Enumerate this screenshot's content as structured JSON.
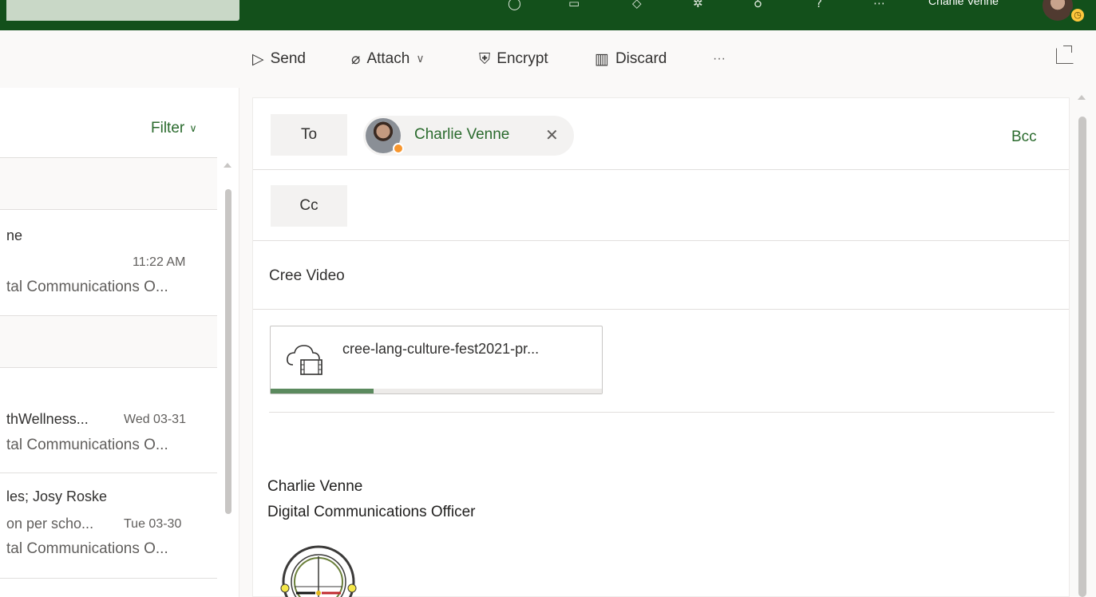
{
  "topbar": {
    "user_name": "Charlie Venne",
    "icons": [
      "skype-icon",
      "calendar-icon",
      "diamond-icon",
      "gear-icon",
      "lightbulb-icon",
      "help-icon",
      "feedback-icon"
    ],
    "bg_color": "#13501b"
  },
  "toolbar": {
    "send_label": "Send",
    "attach_label": "Attach",
    "encrypt_label": "Encrypt",
    "discard_label": "Discard",
    "more_label": "···"
  },
  "list": {
    "filter_label": "Filter",
    "items": [
      {
        "sender": "ne",
        "time": "11:22 AM",
        "preview": "tal Communications O..."
      },
      {
        "sender": "thWellness...",
        "time": "Wed 03-31",
        "preview": "tal Communications O..."
      },
      {
        "sender": "les; Josy Roske",
        "subject": "on per scho...",
        "time": "Tue 03-30",
        "preview": "tal Communications O..."
      }
    ]
  },
  "compose": {
    "to_label": "To",
    "cc_label": "Cc",
    "bcc_label": "Bcc",
    "recipient_name": "Charlie Venne",
    "subject": "Cree Video",
    "attachment": {
      "name": "cree-lang-culture-fest2021-pr...",
      "progress": 0.31
    },
    "signature": {
      "name": "Charlie Venne",
      "title": "Digital Communications Officer"
    }
  },
  "colors": {
    "accent": "#2b6b2e",
    "progress": "#5b8a5e",
    "presence_away": "#f7962e"
  }
}
